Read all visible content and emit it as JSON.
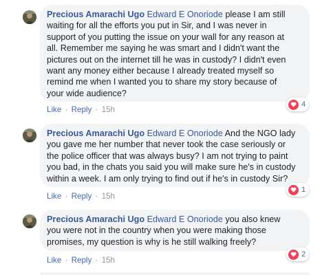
{
  "comments": [
    {
      "author": "Precious Amarachi Ugo",
      "mention": "Edward E Onoriode",
      "lines": [
        " please I am still",
        "waiting for all the efforts you put in Sir, and I was never in",
        "support of you putting the issue on your wall for any reason at",
        "all. Remember me saying he was smart and I didn't want the",
        "pictures out on the internet till he was in custody? I didn't even",
        "want any money either because I already treated myself so",
        "remind me when I wanted you to share my story because of",
        "your wide audience?"
      ],
      "like_label": "Like",
      "reply_label": "Reply",
      "time": "15h",
      "reaction_count": "4"
    },
    {
      "author": "Precious Amarachi Ugo",
      "mention": "Edward E Onoriode",
      "lines": [
        " And the NGO lady",
        "you gave me her number that never took the case seriously or",
        "the police officer that was always busy? I am not trying to paint",
        "you bad, in the chats you said you will make sure he's in custody",
        "within a week. I am only trying to find out if he's in custody Sir?"
      ],
      "like_label": "Like",
      "reply_label": "Reply",
      "time": "15h",
      "reaction_count": "1"
    },
    {
      "author": "Precious Amarachi Ugo",
      "mention": "Edward E Onoriode",
      "lines": [
        " you also knew",
        "you were not in the country when you were making those",
        "promises, my question is why is he still walking freely?"
      ],
      "like_label": "Like",
      "reply_label": "Reply",
      "time": "15h",
      "reaction_count": "2"
    }
  ],
  "separator": "·",
  "colors": {
    "name_link": "#385898",
    "action_link": "#4267b2",
    "bubble_bg": "#f2f3f5",
    "love_reaction": "#f33e58"
  },
  "icons": {
    "avatar": "profile-photo",
    "reaction": "love-heart-icon"
  }
}
